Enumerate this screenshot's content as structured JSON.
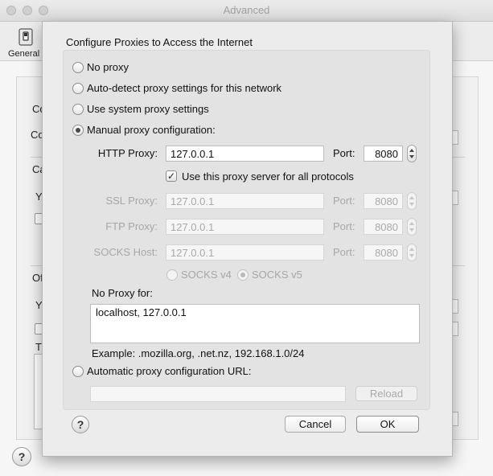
{
  "window": {
    "title": "Advanced"
  },
  "toolbar": {
    "general_label": "General",
    "general_icon": "switch-icon"
  },
  "background": {
    "fragments": [
      "Co",
      "Co",
      "Ca",
      "Yo",
      "Of",
      "Yo",
      "Th"
    ]
  },
  "dialog": {
    "title": "Configure Proxies to Access the Internet",
    "radios": {
      "no_proxy": "No proxy",
      "auto_detect": "Auto-detect proxy settings for this network",
      "system": "Use system proxy settings",
      "manual": "Manual proxy configuration:",
      "auto_url": "Automatic proxy configuration URL:",
      "selected": "manual"
    },
    "http": {
      "label": "HTTP Proxy:",
      "host": "127.0.0.1",
      "port_label": "Port:",
      "port": "8080"
    },
    "same_proxy": {
      "label": "Use this proxy server for all protocols",
      "checked": true
    },
    "ssl": {
      "label": "SSL Proxy:",
      "host": "127.0.0.1",
      "port_label": "Port:",
      "port": "8080"
    },
    "ftp": {
      "label": "FTP Proxy:",
      "host": "127.0.0.1",
      "port_label": "Port:",
      "port": "8080"
    },
    "socks": {
      "label": "SOCKS Host:",
      "host": "127.0.0.1",
      "port_label": "Port:",
      "port": "8080"
    },
    "socks_version": {
      "v4": "SOCKS v4",
      "v5": "SOCKS v5",
      "selected": "v5"
    },
    "no_proxy_for": {
      "label": "No Proxy for:",
      "value": "localhost, 127.0.0.1"
    },
    "example": "Example: .mozilla.org, .net.nz, 192.168.1.0/24",
    "auto_url_value": "",
    "reload_label": "Reload",
    "cancel_label": "Cancel",
    "ok_label": "OK",
    "help_label": "?"
  },
  "bg_help_label": "?"
}
